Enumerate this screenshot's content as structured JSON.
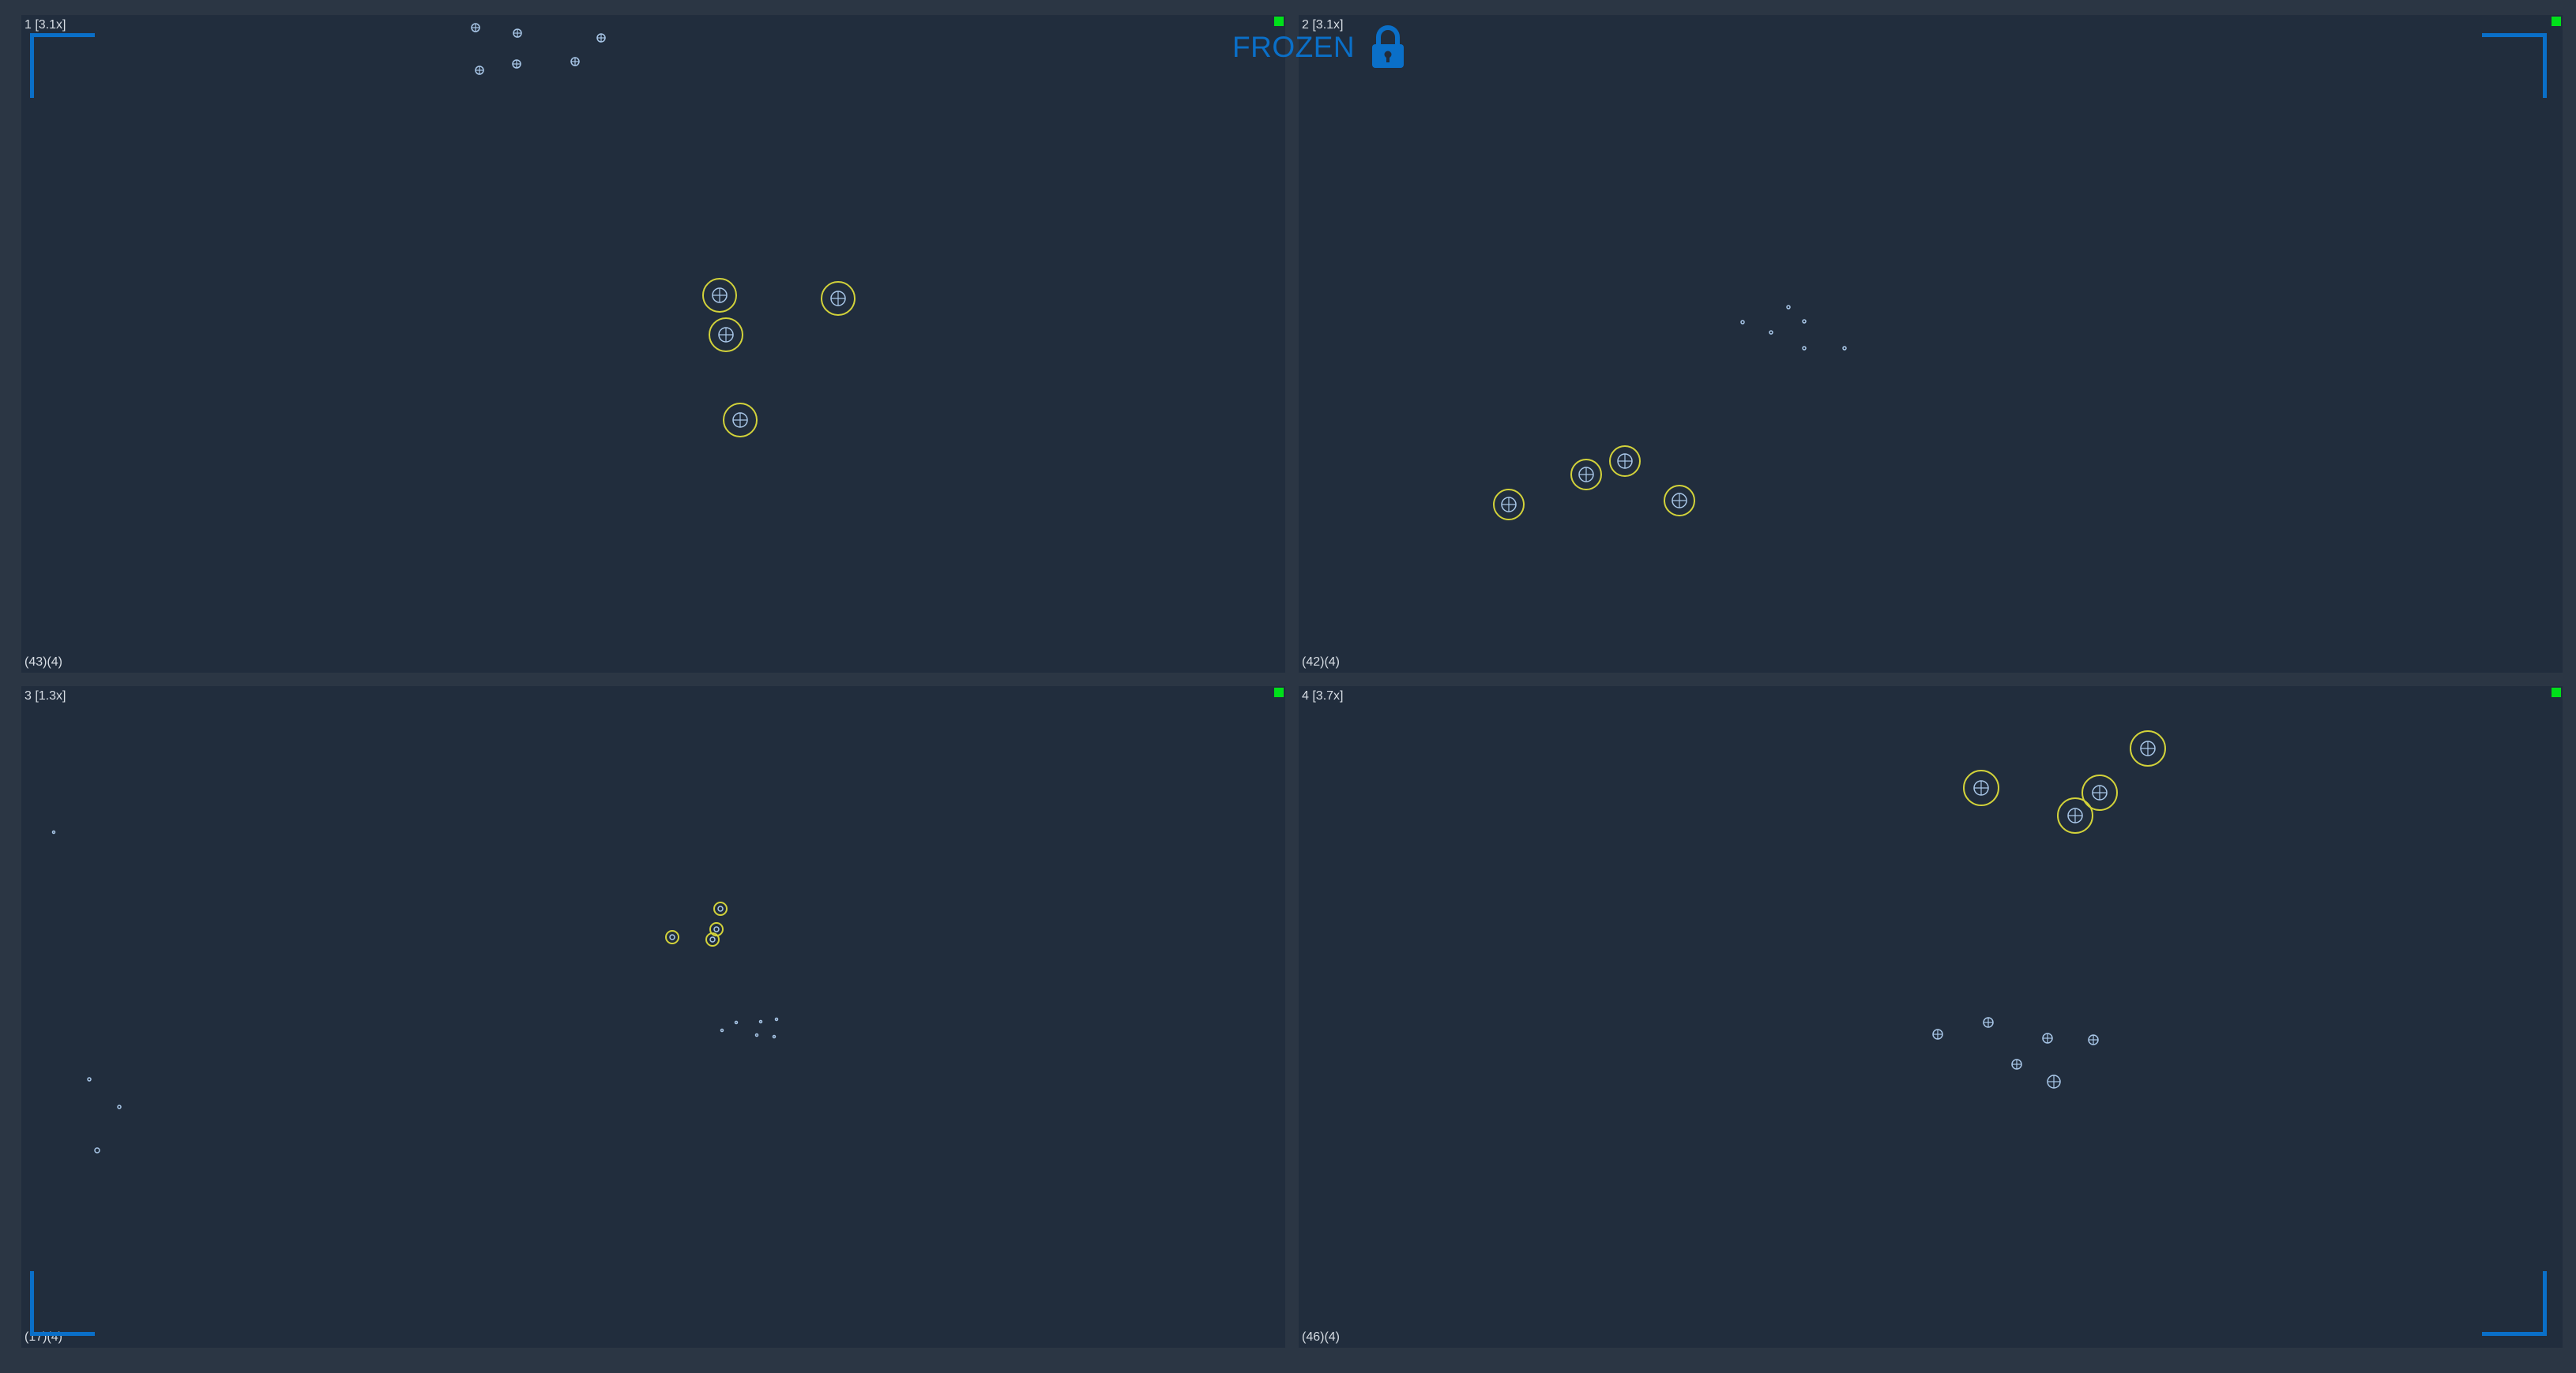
{
  "colors": {
    "background": "#2b3644",
    "viewport": "#212d3d",
    "label_text": "#d7dde4",
    "status_indicator": "#00e01a",
    "accent": "#0a6fc8",
    "selection_ring": "#d2d23a",
    "target_marker": "#a9c7e8"
  },
  "overlay": {
    "frozen_label": "FROZEN",
    "lock_icon": "lock-icon"
  },
  "viewports": [
    {
      "label": "1 [3.1x]",
      "counts": "(43)(4)",
      "status": "active"
    },
    {
      "label": "2 [3.1x]",
      "counts": "(42)(4)",
      "status": "active"
    },
    {
      "label": "3 [1.3x]",
      "counts": "(17)(4)",
      "status": "active"
    },
    {
      "label": "4 [3.7x]",
      "counts": "(46)(4)",
      "status": "active"
    }
  ]
}
